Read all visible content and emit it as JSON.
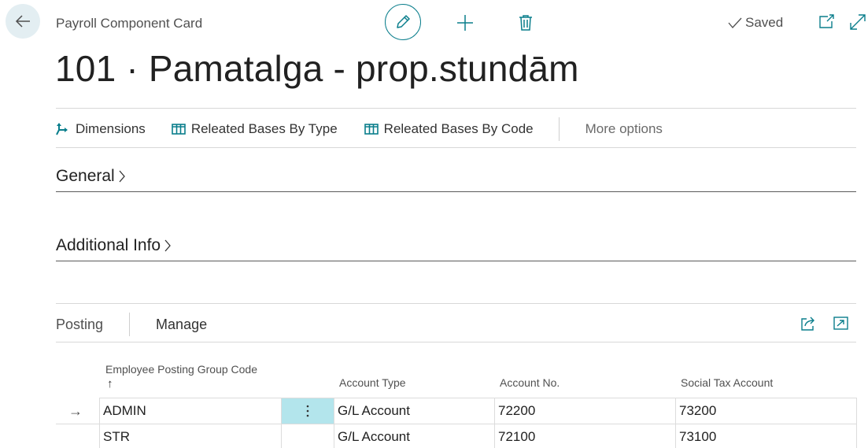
{
  "header": {
    "breadcrumb": "Payroll Component Card",
    "title": "101 · Pamatalga - prop.stundām",
    "saved_label": "Saved"
  },
  "actions": [
    {
      "label": "Dimensions",
      "icon": "dimensions-icon"
    },
    {
      "label": "Releated Bases By Type",
      "icon": "table-icon"
    },
    {
      "label": "Releated Bases By Code",
      "icon": "table-icon"
    },
    {
      "label": "More options",
      "icon": ""
    }
  ],
  "sections": {
    "general": "General",
    "additional": "Additional Info"
  },
  "posting": {
    "tab_posting": "Posting",
    "tab_manage": "Manage",
    "columns": {
      "group_code": "Employee Posting Group Code",
      "sort_arrow": "↑",
      "account_type": "Account Type",
      "account_no": "Account No.",
      "social_tax": "Social Tax Account"
    },
    "rows": [
      {
        "code": "ADMIN",
        "account_type": "G/L Account",
        "account_no": "72200",
        "social_tax": "73200",
        "selected": true
      },
      {
        "code": "STR",
        "account_type": "G/L Account",
        "account_no": "72100",
        "social_tax": "73100",
        "selected": false
      }
    ]
  },
  "colors": {
    "accent": "#0a7e8c",
    "selected_cell": "#b3e5ec"
  }
}
